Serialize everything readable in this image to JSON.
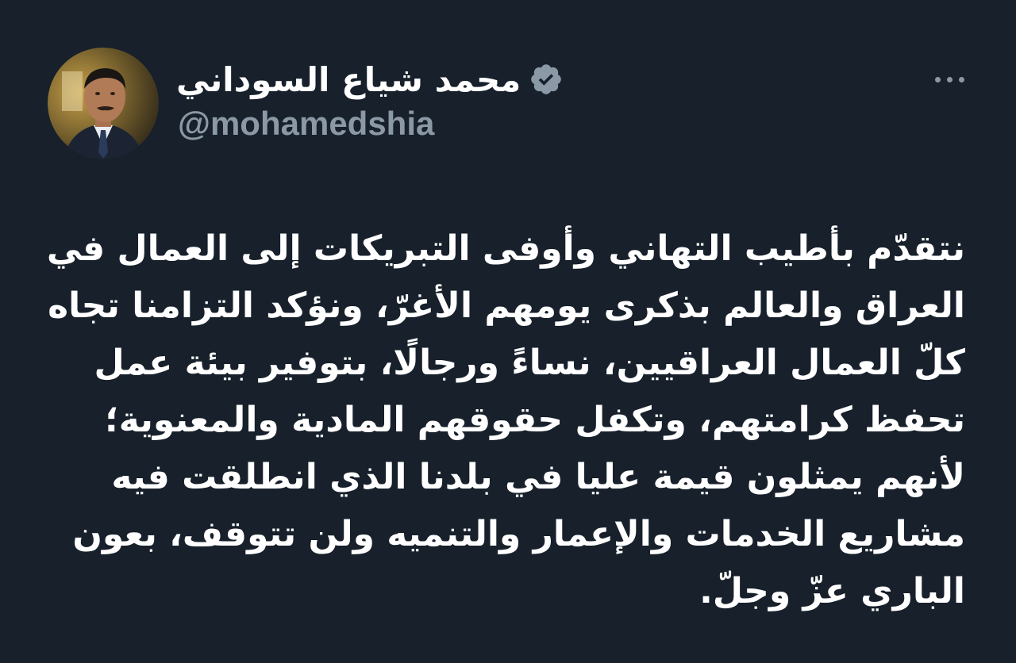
{
  "author": {
    "display_name": "محمد شياع السوداني",
    "handle": "@mohamedshia",
    "verified": true,
    "avatar_icon": "profile-photo"
  },
  "actions": {
    "more_icon": "ellipsis-horizontal-icon"
  },
  "tweet": {
    "lines": [
      "نتقدّم بأطيب التهاني وأوفى التبريكات إلى العمال في",
      "العراق والعالم بذكرى يومهم الأغرّ، ونؤكد التزامنا تجاه",
      "كلّ العمال العراقيين، نساءً ورجالًا، بتوفير بيئة عمل",
      "تحفظ كرامتهم، وتكفل حقوقهم المادية والمعنوية؛",
      "لأنهم يمثلون قيمة عليا في بلدنا الذي انطلقت فيه",
      "مشاريع الخدمات والإعمار والتنميه ولن تتوقف، بعون",
      "الباري عزّ وجلّ."
    ]
  },
  "colors": {
    "background": "#17202b",
    "text_primary": "#ffffff",
    "text_secondary": "#8b98a5",
    "verified_badge": "#8b98a5"
  }
}
